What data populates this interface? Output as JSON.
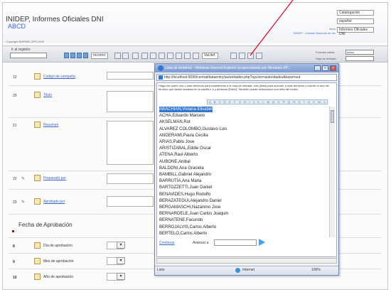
{
  "header": {
    "title": "INIDEP, Informes Oficiales DNI",
    "subtitle": "ABCD",
    "copyright": "- Copyright BIREME-OPS-OMS",
    "links_line1": "Inicio",
    "links_line2": "INIDEP - Instituto Nacional de Inv",
    "select_catalog": "Catalogación",
    "select_language": "español",
    "select_db": "Informes Oficiales DNI"
  },
  "toolbar": {
    "goto_label": "Ir al registro",
    "recorrer_label": "recorrer",
    "valdef_label": "Val.def.",
    "formato_label": "Formato salida",
    "formato_value": "todos",
    "hoja_label": "Hoja de entrada"
  },
  "form": {
    "rows": [
      {
        "num": "12",
        "label": "Codigo de campaña",
        "link": true
      },
      {
        "num": "20",
        "label": "Titulo",
        "link": true
      },
      {
        "num": "21",
        "label": "Resumen",
        "link": true
      },
      {
        "num": "22",
        "label": "Preparado por",
        "link": true
      },
      {
        "num": "23",
        "label": "Aprobado por",
        "link": true
      },
      {
        "num": "8",
        "label": "Día de aprobación",
        "link": false
      },
      {
        "num": "9",
        "label": "Mes de aprobación",
        "link": false
      },
      {
        "num": "10",
        "label": "Año de aprobación",
        "link": false
      }
    ],
    "section_title": "Fecha de Aprobación"
  },
  "popup": {
    "title": "Lista de términos - Windows Internet Explorer proporcionado por Windows XP...",
    "address": "http://localhost:9090/central/dataentry/autoridades.php?opcion=autoridades&base=aut",
    "instructions": "Haga clic sobre uno o más términos para transferirlos a la hoja de entrada. Use [links] para acceder a más términos o inserte la raíz del término que desee localizar en la casilla // a y presione [Enter]. También puede seleccionar una letra del índice.",
    "alphabet": "A B C D E F G H I J K L M N O P Q R S T U V W X Y Z",
    "names": [
      "ABACHIAN,Viviana Elisabet",
      "ACHA,Eduardo Marcelo",
      "AKSELMAN,Rut",
      "ALVAREZ COLOMBO,Gustavo Luis",
      "ANGERAMI,Paula Cecilia",
      "ARIAS,Pablo Jose",
      "ARISTIZABAL,Eddie Oscar",
      "ATENA,Raul Alberto",
      "AUBONE,Anibal",
      "BALDONI,Ana Graciela",
      "BAMBILL,Gabriel Alejandro",
      "BARRUTIA,Ana Maria",
      "BARTOZZETTI,Juan Daniel",
      "BENAVIDES,Hugo Rodolfo",
      "BERAZATEGUI,Alejandro Daniel",
      "BERGAMASCHI,Nazareno Jose",
      "BERNARDELE,Juan Carlos Joaquin",
      "BERNATENE,Facundo",
      "BERROJALVIS,Carlos Alberto",
      "BERTELO,Carlos Alberto"
    ],
    "continuar": "Continuar",
    "avanzar": "Avanzar a",
    "status_left": "Listo",
    "status_zone": "Internet",
    "status_zoom": "100%"
  }
}
